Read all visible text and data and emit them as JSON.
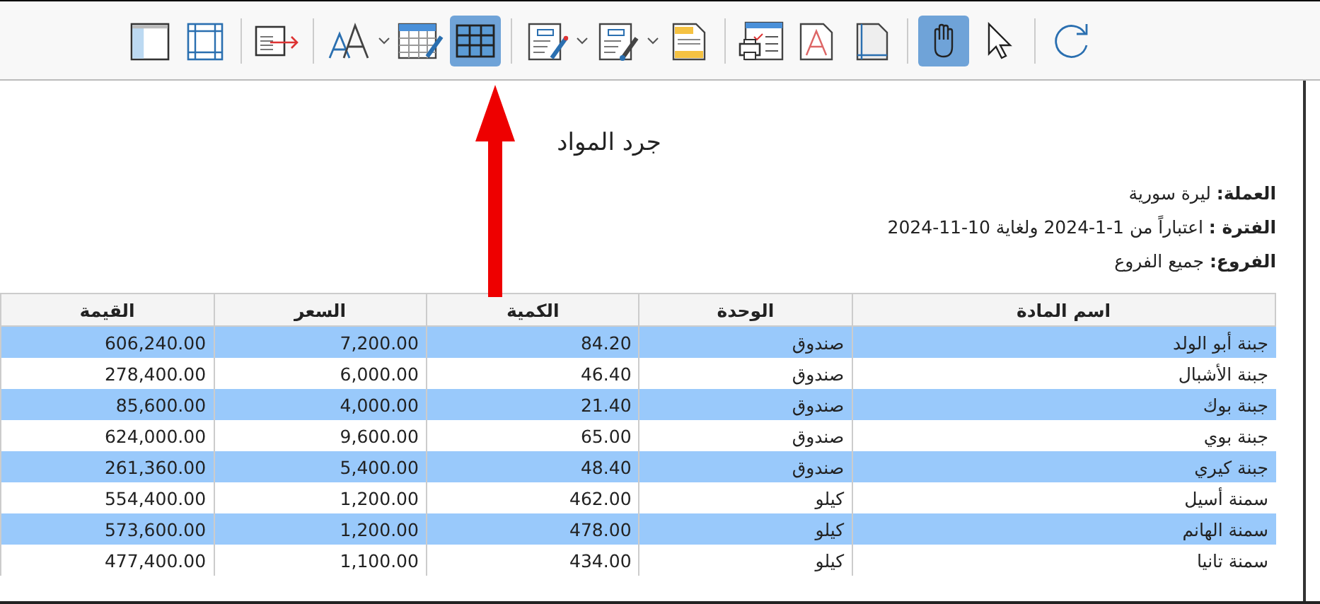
{
  "toolbar": [
    {
      "kind": "button",
      "selected": false
    },
    {
      "kind": "button",
      "selected": false
    },
    {
      "kind": "separator"
    },
    {
      "kind": "button",
      "selected": false
    },
    {
      "kind": "separator"
    },
    {
      "kind": "dropdown",
      "selected": false
    },
    {
      "kind": "button",
      "selected": false
    },
    {
      "kind": "button",
      "selected": true
    },
    {
      "kind": "separator"
    },
    {
      "kind": "dropdown",
      "selected": false
    },
    {
      "kind": "dropdown",
      "selected": false
    },
    {
      "kind": "button",
      "selected": false
    },
    {
      "kind": "separator"
    },
    {
      "kind": "button",
      "selected": false
    },
    {
      "kind": "button",
      "selected": false
    },
    {
      "kind": "button",
      "selected": false
    },
    {
      "kind": "separator"
    },
    {
      "kind": "button",
      "selected": true
    },
    {
      "kind": "button",
      "selected": false
    },
    {
      "kind": "separator"
    },
    {
      "kind": "button",
      "selected": false
    }
  ],
  "report": {
    "title": "جرد المواد",
    "info": [
      "**العملة:** ليرة سورية",
      "**الفترة :** اعتباراً من 1-1-2024 ولغاية 10-11-2024",
      "**الفروع:** جميع الفروع"
    ],
    "table": {
      "columns": [
        "اسم المادة",
        "الوحدة",
        "الكمية",
        "السعر",
        "القيمة"
      ],
      "rows": [
        {
          "highlighted": true,
          "cells": [
            "جبنة أبو الولد",
            "صندوق",
            "84.20",
            "7,200.00",
            "606,240.00"
          ]
        },
        {
          "highlighted": false,
          "cells": [
            "جبنة الأشبال",
            "صندوق",
            "46.40",
            "6,000.00",
            "278,400.00"
          ]
        },
        {
          "highlighted": true,
          "cells": [
            "جبنة بوك",
            "صندوق",
            "21.40",
            "4,000.00",
            "85,600.00"
          ]
        },
        {
          "highlighted": false,
          "cells": [
            "جبنة بوي",
            "صندوق",
            "65.00",
            "9,600.00",
            "624,000.00"
          ]
        },
        {
          "highlighted": true,
          "cells": [
            "جبنة كيري",
            "صندوق",
            "48.40",
            "5,400.00",
            "261,360.00"
          ]
        },
        {
          "highlighted": false,
          "cells": [
            "سمنة أسيل",
            "كيلو",
            "462.00",
            "1,200.00",
            "554,400.00"
          ]
        },
        {
          "highlighted": true,
          "cells": [
            "سمنة الهانم",
            "كيلو",
            "478.00",
            "1,200.00",
            "573,600.00"
          ]
        },
        {
          "highlighted": false,
          "cells": [
            "سمنة تانيا",
            "كيلو",
            "434.00",
            "1,100.00",
            "477,400.00"
          ]
        }
      ]
    }
  }
}
